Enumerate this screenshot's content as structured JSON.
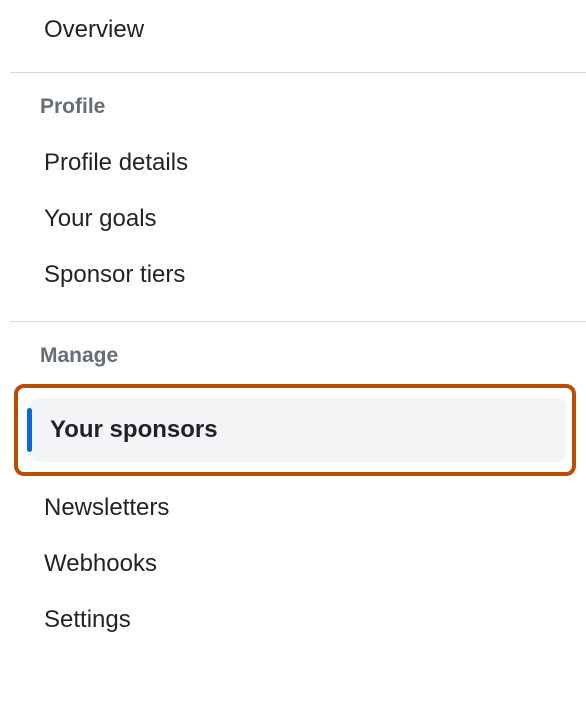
{
  "nav": {
    "overview": "Overview"
  },
  "sections": {
    "profile": {
      "header": "Profile",
      "items": {
        "profile_details": "Profile details",
        "your_goals": "Your goals",
        "sponsor_tiers": "Sponsor tiers"
      }
    },
    "manage": {
      "header": "Manage",
      "items": {
        "your_sponsors": "Your sponsors",
        "newsletters": "Newsletters",
        "webhooks": "Webhooks",
        "settings": "Settings"
      }
    }
  }
}
